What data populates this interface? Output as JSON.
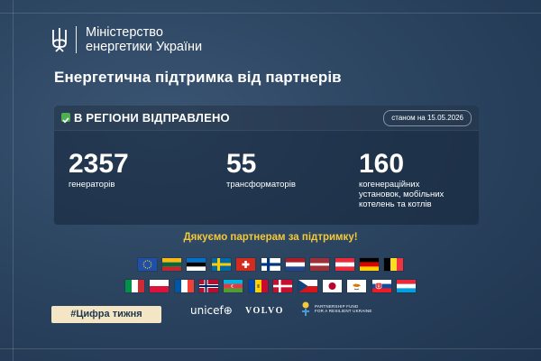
{
  "header": {
    "ministry_line1": "Міністерство",
    "ministry_line2": "енергетики України",
    "emblem_icon": "tryzub-icon"
  },
  "title": "Енергетична підтримка від партнерів",
  "panel": {
    "region_label": "В РЕГІОНИ ВІДПРАВЛЕНО",
    "date_text": "станом на 15.05.2026",
    "stats": [
      {
        "value": "2357",
        "label_lines": [
          "генераторів"
        ]
      },
      {
        "value": "55",
        "label_lines": [
          "трансформаторів"
        ]
      },
      {
        "value": "160",
        "label_lines": [
          "когенераційних",
          "установок, мобільних",
          "котелень та котлів"
        ]
      }
    ]
  },
  "thanks": "Дякуємо партнерам за підтримку!",
  "flags_row1": [
    "eu",
    "lithuania",
    "estonia",
    "sweden",
    "switzerland",
    "finland",
    "netherlands",
    "latvia",
    "austria",
    "germany",
    "belgium"
  ],
  "flags_row2": [
    "italy",
    "poland",
    "france",
    "norway",
    "azerbaijan",
    "moldova",
    "denmark",
    "czechia",
    "japan",
    "cyprus",
    "slovakia",
    "luxembourg"
  ],
  "hashtag": "#Цифра тижня",
  "partners": {
    "unicef": "unicef",
    "volvo": "VOLVO",
    "fund_line1": "PARTNERSHIP FUND",
    "fund_line2": "FOR A RESILIENT UKRAINE"
  },
  "colors": {
    "background": "#2c4561",
    "accent_yellow": "#f3c93a",
    "check_green": "#4caf50",
    "hashtag_bg": "#f4e6c4"
  }
}
